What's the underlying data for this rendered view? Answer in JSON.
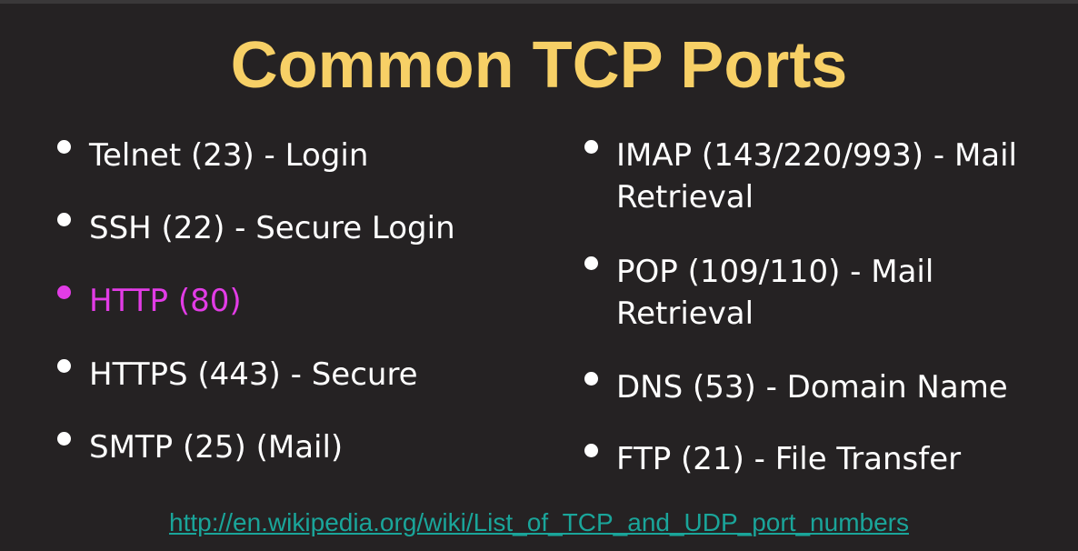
{
  "slide": {
    "title": "Common TCP Ports",
    "left_items": [
      {
        "text": "Telnet (23) - Login"
      },
      {
        "text": "SSH (22) - Secure Login"
      },
      {
        "text": "HTTP (80)"
      },
      {
        "text": "HTTPS (443) - Secure"
      },
      {
        "text": "SMTP (25) (Mail)"
      }
    ],
    "right_items": [
      {
        "line1": "IMAP (143/220/993) - Mail",
        "line2": "Retrieval"
      },
      {
        "line1": "POP (109/110) - Mail",
        "line2": "Retrieval"
      },
      {
        "line1": "DNS (53) - Domain Name"
      },
      {
        "line1": "FTP (21) - File Transfer"
      }
    ],
    "link": "http://en.wikipedia.org/wiki/List_of_TCP_and_UDP_port_numbers"
  },
  "colors": {
    "background": "#252223",
    "title": "#f7d066",
    "text": "#ffffff",
    "highlight": "#e23ce6",
    "link": "#1aa59a"
  }
}
